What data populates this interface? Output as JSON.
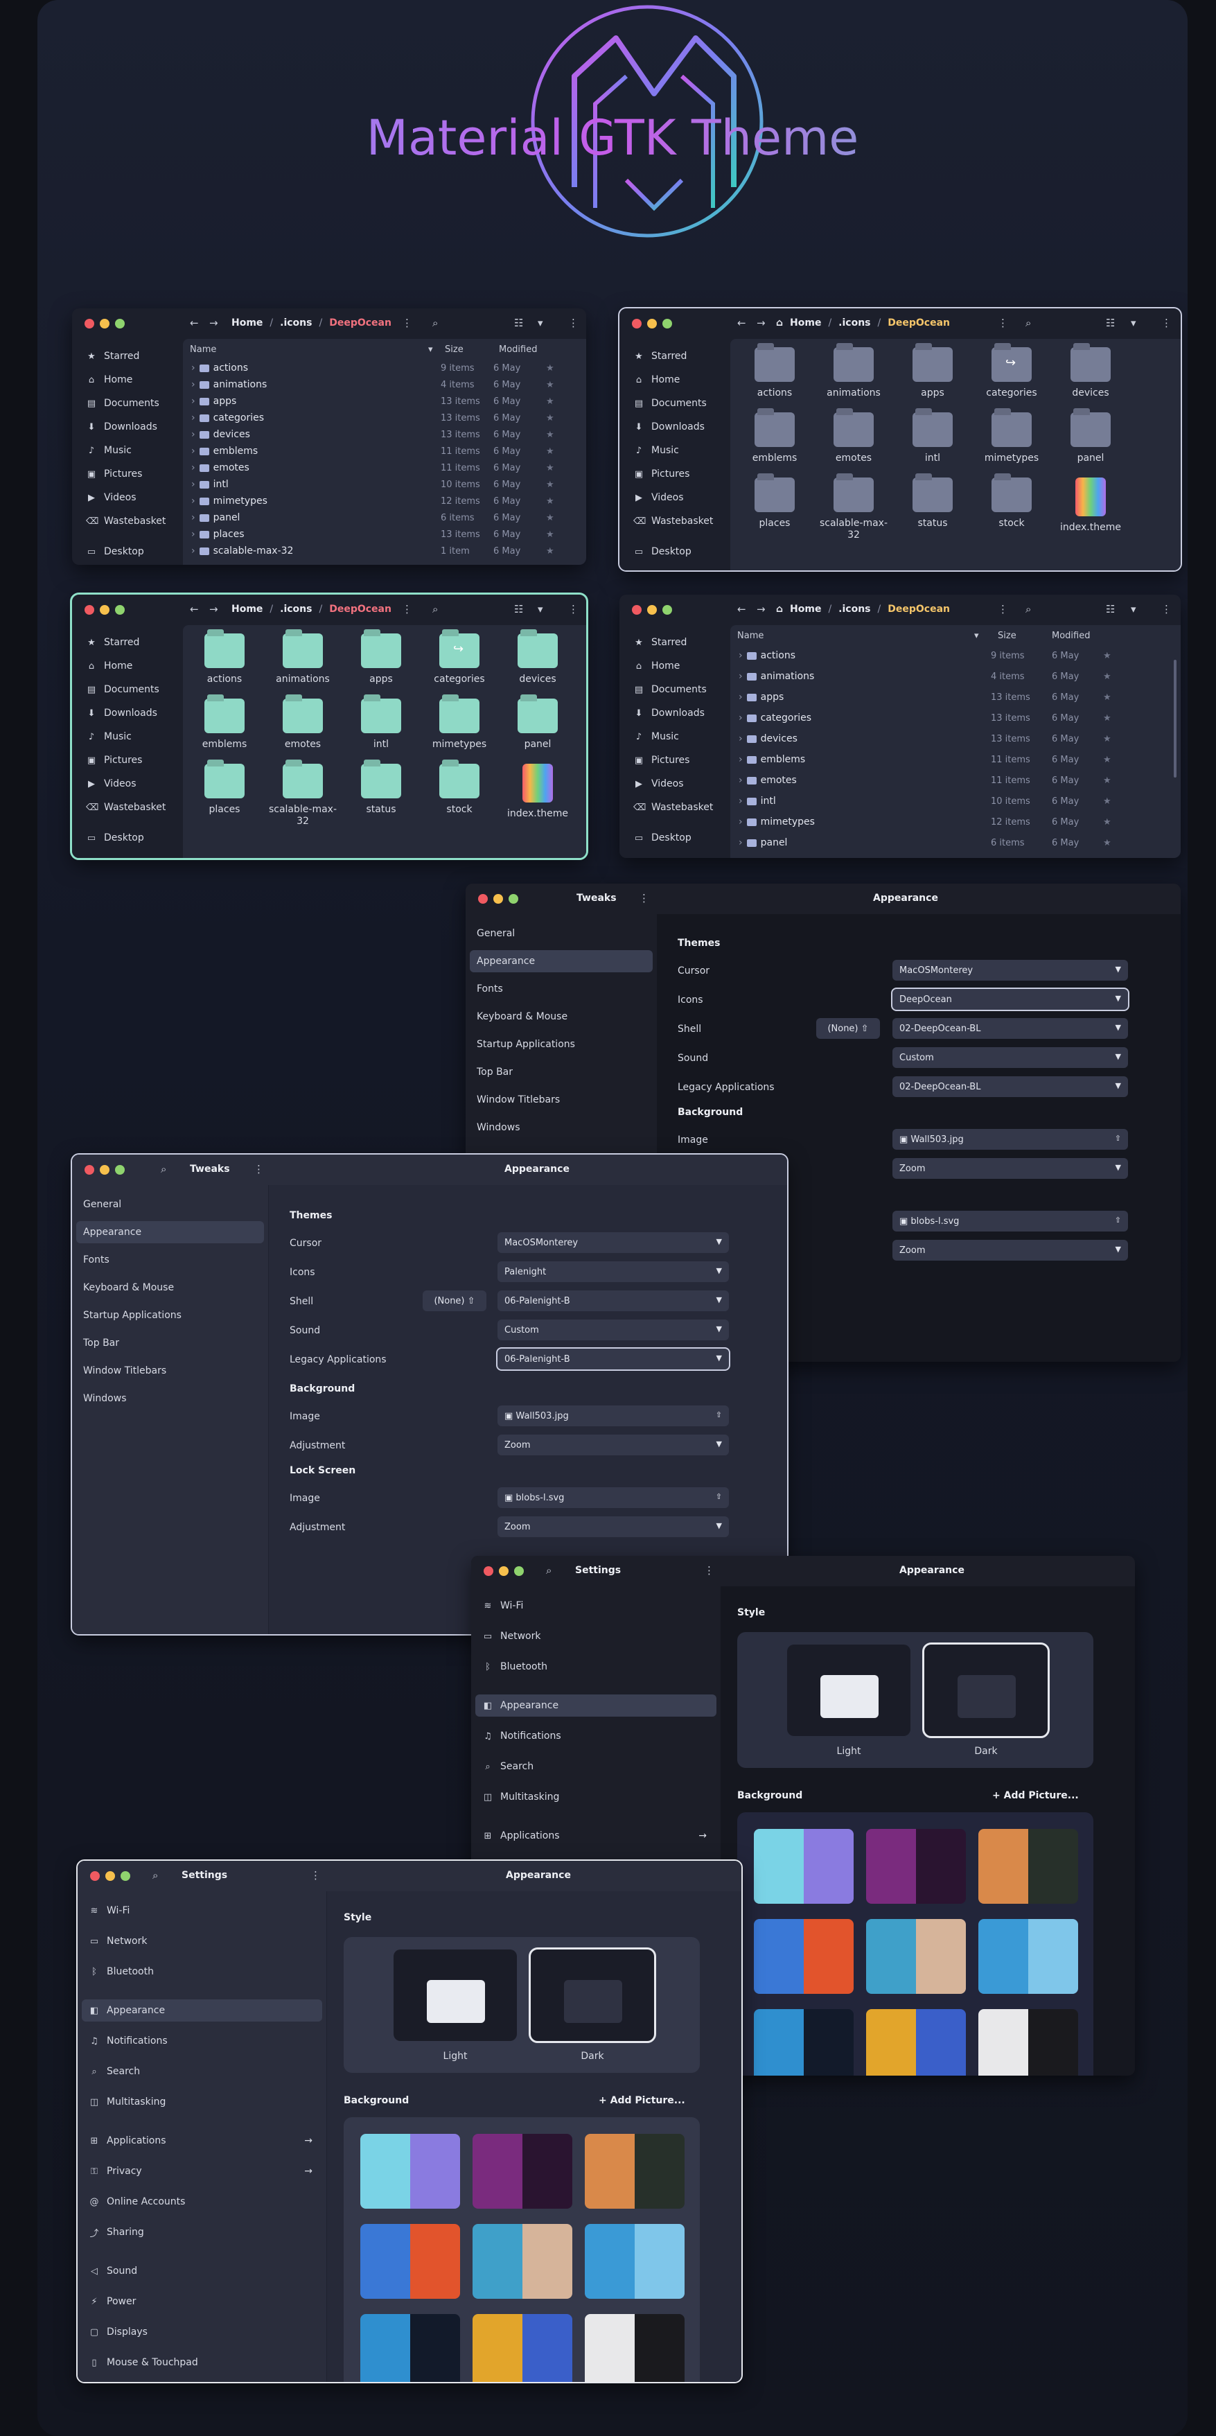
{
  "header": {
    "title": "Material GTK Theme"
  },
  "colors": {
    "accent_red": "#f2727f",
    "accent_yellow": "#f4c56a",
    "teal": "#8fd9c6",
    "grey_folder": "#767d96"
  },
  "sidebar_places": [
    "Starred",
    "Home",
    "Documents",
    "Downloads",
    "Music",
    "Pictures",
    "Videos",
    "Wastebasket",
    "Desktop"
  ],
  "sidebar_icons": [
    "star-icon",
    "home-icon",
    "document-icon",
    "download-icon",
    "music-icon",
    "picture-icon",
    "video-icon",
    "trash-icon",
    "desktop-icon"
  ],
  "path": {
    "home": "Home",
    "icons": ".icons",
    "current": "DeepOcean"
  },
  "list_headers": {
    "name": "Name",
    "size": "Size",
    "modified": "Modified"
  },
  "files": [
    {
      "name": "actions",
      "size": "9 items",
      "modified": "6 May"
    },
    {
      "name": "animations",
      "size": "4 items",
      "modified": "6 May"
    },
    {
      "name": "apps",
      "size": "13 items",
      "modified": "6 May"
    },
    {
      "name": "categories",
      "size": "13 items",
      "modified": "6 May"
    },
    {
      "name": "devices",
      "size": "13 items",
      "modified": "6 May"
    },
    {
      "name": "emblems",
      "size": "11 items",
      "modified": "6 May"
    },
    {
      "name": "emotes",
      "size": "11 items",
      "modified": "6 May"
    },
    {
      "name": "intl",
      "size": "10 items",
      "modified": "6 May"
    },
    {
      "name": "mimetypes",
      "size": "12 items",
      "modified": "6 May"
    },
    {
      "name": "panel",
      "size": "6 items",
      "modified": "6 May"
    },
    {
      "name": "places",
      "size": "13 items",
      "modified": "6 May"
    },
    {
      "name": "scalable-max-32",
      "size": "1 item",
      "modified": "6 May"
    }
  ],
  "grid_items": [
    "actions",
    "animations",
    "apps",
    "categories",
    "devices",
    "emblems",
    "emotes",
    "intl",
    "mimetypes",
    "panel",
    "places",
    "scalable-max-32",
    "status",
    "stock",
    "index.theme"
  ],
  "tweaks": {
    "title": "Tweaks",
    "page_title": "Appearance",
    "nav": [
      "General",
      "Appearance",
      "Fonts",
      "Keyboard & Mouse",
      "Startup Applications",
      "Top Bar",
      "Window Titlebars",
      "Windows"
    ],
    "themes_header": "Themes",
    "labels": {
      "cursor": "Cursor",
      "icons": "Icons",
      "shell": "Shell",
      "sound": "Sound",
      "legacy": "Legacy Applications",
      "image": "Image",
      "adjustment": "Adjustment"
    },
    "none_button": "(None)",
    "background_header": "Background",
    "lock_header": "Lock Screen",
    "deepocean": {
      "cursor": "MacOSMonterey",
      "icons": "DeepOcean",
      "shell": "02-DeepOcean-BL",
      "sound": "Custom",
      "legacy": "02-DeepOcean-BL",
      "bg_image": "Wall503.jpg",
      "bg_adjust": "Zoom",
      "lock_image": "blobs-l.svg",
      "lock_adjust": "Zoom"
    },
    "palenight": {
      "cursor": "MacOSMonterey",
      "icons": "Palenight",
      "shell": "06-Palenight-B",
      "sound": "Custom",
      "legacy": "06-Palenight-B",
      "bg_image": "Wall503.jpg",
      "bg_adjust": "Zoom",
      "lock_image": "blobs-l.svg",
      "lock_adjust": "Zoom"
    }
  },
  "settings": {
    "title": "Settings",
    "page_title": "Appearance",
    "nav_a": [
      "Wi-Fi",
      "Network",
      "Bluetooth"
    ],
    "nav_b": [
      "Appearance",
      "Notifications",
      "Search",
      "Multitasking"
    ],
    "nav_c": [
      "Applications",
      "Privacy",
      "Online Accounts",
      "Sharing"
    ],
    "nav_d": [
      "Sound",
      "Power",
      "Displays",
      "Mouse & Touchpad"
    ],
    "style_header": "Style",
    "style_light": "Light",
    "style_dark": "Dark",
    "background_header": "Background",
    "add_picture": "Add Picture..."
  }
}
